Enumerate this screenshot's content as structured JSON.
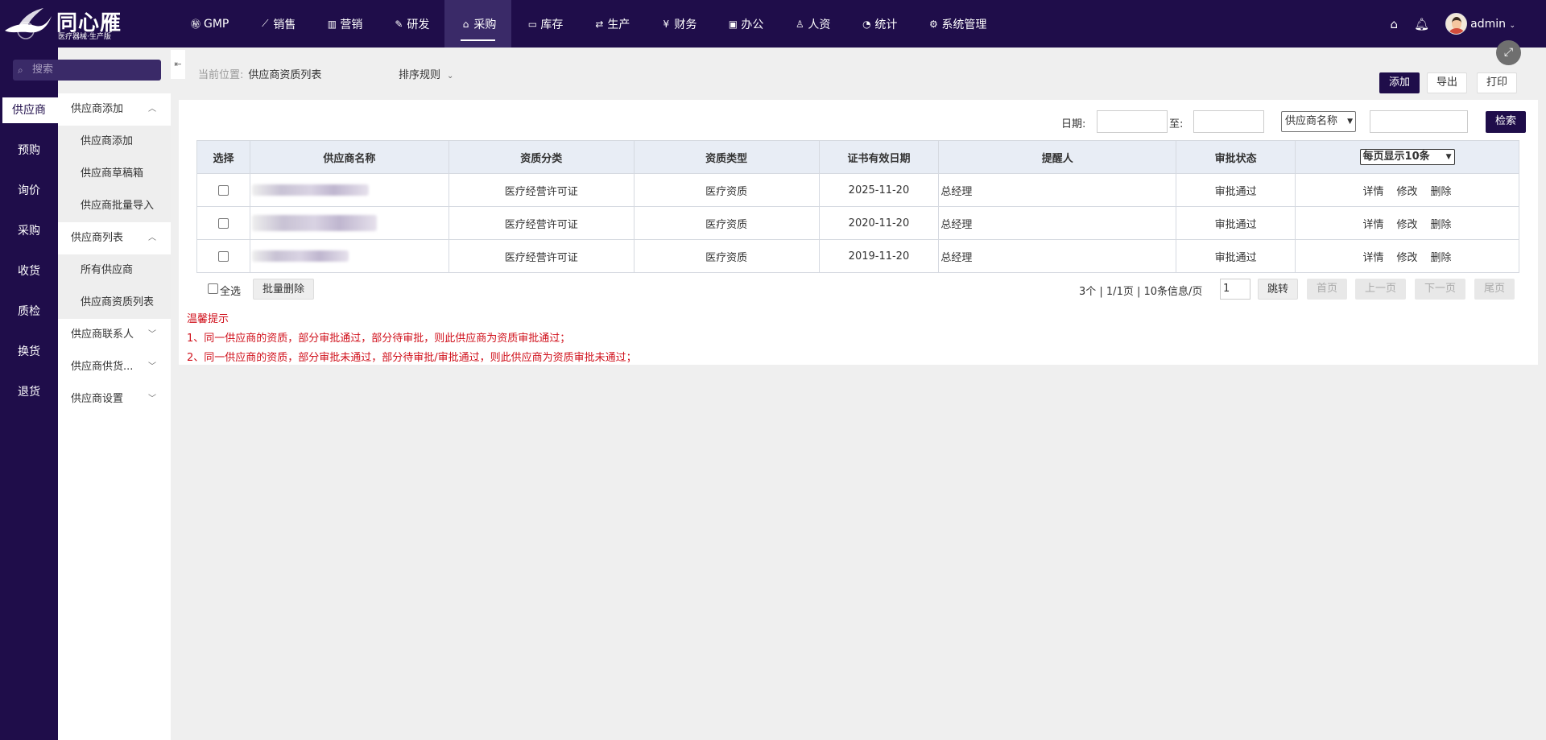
{
  "brand": {
    "name": "同心雁",
    "subtitle": "医疗器械·生产版"
  },
  "nav": [
    {
      "icon": "gmp-icon",
      "glyph": "㊙",
      "label": "GMP"
    },
    {
      "icon": "sales-chart-icon",
      "glyph": "⟋",
      "label": "销售"
    },
    {
      "icon": "bar-chart-icon",
      "glyph": "▥",
      "label": "营销"
    },
    {
      "icon": "research-icon",
      "glyph": "✎",
      "label": "研发"
    },
    {
      "icon": "basket-icon",
      "glyph": "⌂",
      "label": "采购",
      "active": true
    },
    {
      "icon": "inventory-icon",
      "glyph": "▭",
      "label": "库存"
    },
    {
      "icon": "production-icon",
      "glyph": "⇄",
      "label": "生产"
    },
    {
      "icon": "yen-icon",
      "glyph": "¥",
      "label": "财务"
    },
    {
      "icon": "briefcase-icon",
      "glyph": "▣",
      "label": "办公"
    },
    {
      "icon": "user-icon",
      "glyph": "♙",
      "label": "人资"
    },
    {
      "icon": "pie-chart-icon",
      "glyph": "◔",
      "label": "统计"
    },
    {
      "icon": "settings-icon",
      "glyph": "⚙",
      "label": "系统管理"
    }
  ],
  "user": {
    "name": "admin"
  },
  "search": {
    "placeholder": "搜索"
  },
  "leftcol": [
    "供应商",
    "预购",
    "询价",
    "采购",
    "收货",
    "质检",
    "换货",
    "退货"
  ],
  "submenu": {
    "group1": "供应商添加",
    "group1_items": [
      "供应商添加",
      "供应商草稿箱",
      "供应商批量导入"
    ],
    "group2": "供应商列表",
    "group2_items": [
      "所有供应商",
      "供应商资质列表"
    ],
    "group3": "供应商联系人",
    "group4": "供应商供货...",
    "group5": "供应商设置"
  },
  "breadcrumb": {
    "label": "当前位置:",
    "current": "供应商资质列表"
  },
  "sort_label": "排序规则",
  "actions": {
    "add": "添加",
    "export": "导出",
    "print": "打印"
  },
  "filter": {
    "date_label": "日期:",
    "to_label": "至:",
    "field_select": "供应商名称",
    "search_button": "检索"
  },
  "table": {
    "headers": [
      "选择",
      "供应商名称",
      "资质分类",
      "资质类型",
      "证书有效日期",
      "提醒人",
      "审批状态"
    ],
    "page_size_select": "每页显示10条",
    "rows": [
      {
        "category": "医疗经营许可证",
        "type": "医疗资质",
        "expiry": "2025-11-20",
        "reminder": "总经理",
        "status": "审批通过"
      },
      {
        "category": "医疗经营许可证",
        "type": "医疗资质",
        "expiry": "2020-11-20",
        "reminder": "总经理",
        "status": "审批通过"
      },
      {
        "category": "医疗经营许可证",
        "type": "医疗资质",
        "expiry": "2019-11-20",
        "reminder": "总经理",
        "status": "审批通过"
      }
    ],
    "ops": {
      "detail": "详情",
      "edit": "修改",
      "delete": "删除"
    }
  },
  "bulk": {
    "select_all": "全选",
    "batch_delete": "批量删除"
  },
  "pagination": {
    "summary": "3个 | 1/1页 |  10条信息/页",
    "page_input": "1",
    "jump": "跳转",
    "first": "首页",
    "prev": "上一页",
    "next": "下一页",
    "last": "尾页"
  },
  "tips": {
    "title": "温馨提示",
    "line1": "1、同一供应商的资质，部分审批通过，部分待审批，则此供应商为资质审批通过；",
    "line2": "2、同一供应商的资质，部分审批未通过，部分待审批/审批通过，则此供应商为资质审批未通过；"
  },
  "colors": {
    "primary": "#1f0d4a",
    "tip": "#d0101b",
    "header_bg": "#e8edf5"
  }
}
